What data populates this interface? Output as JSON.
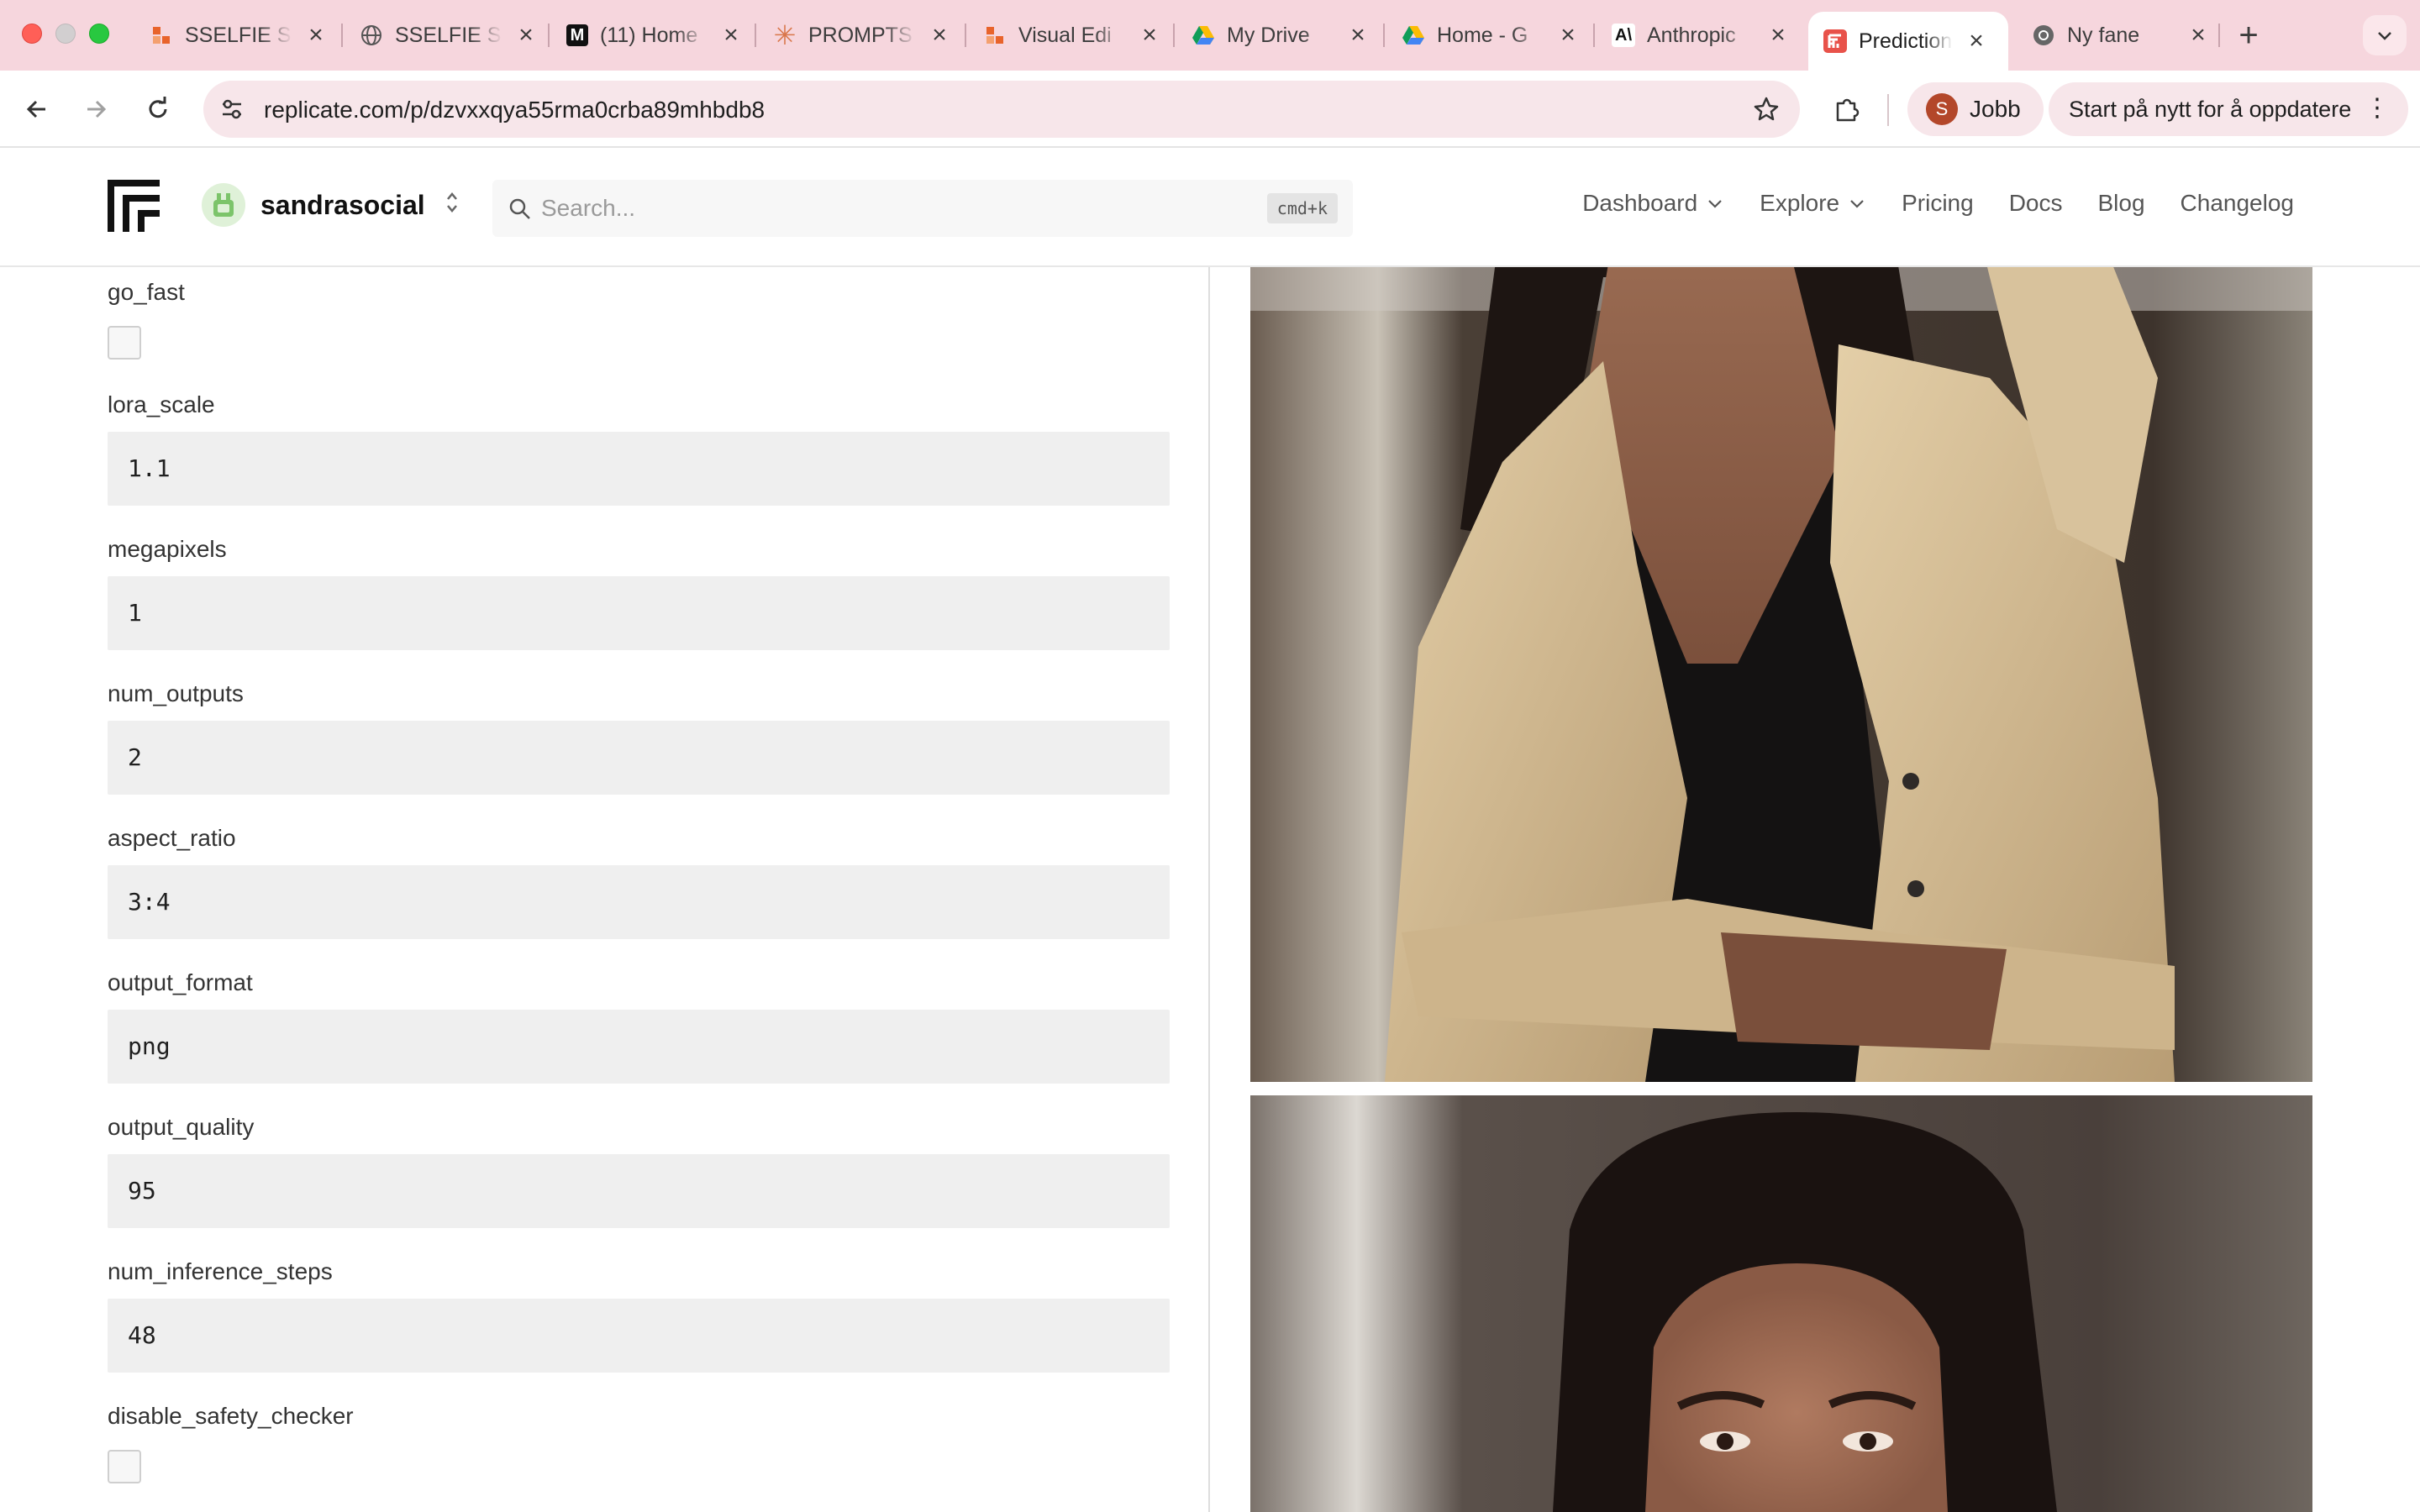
{
  "browser": {
    "tabs": [
      {
        "title": "SSELFIE S",
        "favicon": "orange-squares-icon"
      },
      {
        "title": "SSELFIE S",
        "favicon": "globe-icon"
      },
      {
        "title": "(11) Home",
        "favicon": "m-logo-icon"
      },
      {
        "title": "PROMPTS",
        "favicon": "asterisk-icon"
      },
      {
        "title": "Visual Edi",
        "favicon": "orange-squares-icon"
      },
      {
        "title": "My Drive",
        "favicon": "drive-icon"
      },
      {
        "title": "Home - G",
        "favicon": "drive-icon"
      },
      {
        "title": "Anthropic",
        "favicon": "anthropic-icon"
      },
      {
        "title": "Prediction",
        "favicon": "replicate-icon",
        "active": true
      },
      {
        "title": "Ny fane",
        "favicon": "chrome-icon"
      }
    ],
    "url": "replicate.com/p/dzvxxqya55rma0crba89mhbdb8",
    "profile_initial": "S",
    "profile_name": "Jobb",
    "update_label": "Start på nytt for å oppdatere",
    "accent_color": "#f6d6dd"
  },
  "header": {
    "account_name": "sandrasocial",
    "search_placeholder": "Search...",
    "search_shortcut": "cmd+k",
    "nav": [
      {
        "label": "Dashboard",
        "has_menu": true
      },
      {
        "label": "Explore",
        "has_menu": true
      },
      {
        "label": "Pricing"
      },
      {
        "label": "Docs"
      },
      {
        "label": "Blog"
      },
      {
        "label": "Changelog"
      }
    ]
  },
  "form": {
    "go_fast": {
      "label": "go_fast",
      "checked": false
    },
    "lora_scale": {
      "label": "lora_scale",
      "value": "1.1"
    },
    "megapixels": {
      "label": "megapixels",
      "value": "1"
    },
    "num_outputs": {
      "label": "num_outputs",
      "value": "2"
    },
    "aspect_ratio": {
      "label": "aspect_ratio",
      "value": "3:4"
    },
    "output_format": {
      "label": "output_format",
      "value": "png"
    },
    "output_quality": {
      "label": "output_quality",
      "value": "95"
    },
    "num_inference_steps": {
      "label": "num_inference_steps",
      "value": "48"
    },
    "disable_safety_checker": {
      "label": "disable_safety_checker",
      "checked": false
    }
  }
}
